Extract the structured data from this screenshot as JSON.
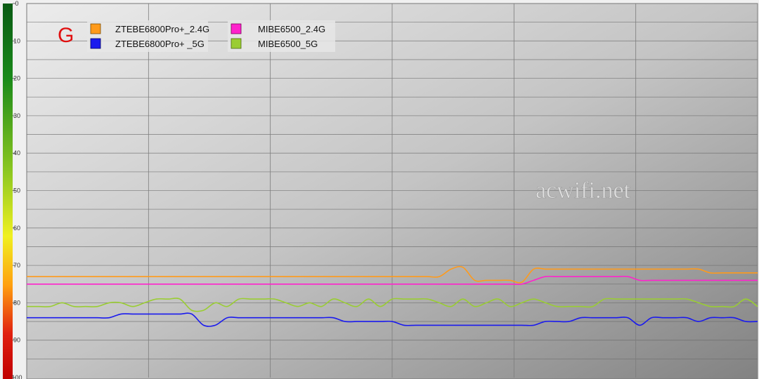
{
  "chart_data": {
    "type": "line",
    "ylim": [
      0,
      100
    ],
    "y_inverted": true,
    "y_ticks": [
      "0",
      "10",
      "20",
      "30",
      "40",
      "50",
      "60",
      "70",
      "80",
      "90",
      "100"
    ],
    "grid": true,
    "legend_position": "top-left",
    "marker_label": "G",
    "watermark": "acwifi.net",
    "x": [
      0,
      1,
      2,
      3,
      4,
      5,
      6,
      7,
      8,
      9,
      10,
      11,
      12,
      13,
      14,
      15,
      16,
      17,
      18,
      19,
      20,
      21,
      22,
      23,
      24,
      25,
      26,
      27,
      28,
      29,
      30,
      31,
      32,
      33,
      34,
      35,
      36,
      37,
      38,
      39,
      40,
      41,
      42,
      43,
      44,
      45,
      46,
      47,
      48,
      49,
      50,
      51,
      52,
      53,
      54,
      55,
      56,
      57,
      58,
      59,
      60,
      61,
      62
    ],
    "series": [
      {
        "name": "ZTEBE6800Pro+_2.4G",
        "color": "#ff9a1a",
        "values": [
          73,
          73,
          73,
          73,
          73,
          73,
          73,
          73,
          73,
          73,
          73,
          73,
          73,
          73,
          73,
          73,
          73,
          73,
          73,
          73,
          73,
          73,
          73,
          73,
          73,
          73,
          73,
          73,
          73,
          73,
          73,
          73,
          73,
          73,
          73,
          73,
          71,
          70.5,
          74,
          74,
          74,
          74,
          74.5,
          71,
          71,
          71,
          71,
          71,
          71,
          71,
          71,
          71,
          71,
          71,
          71,
          71,
          71,
          71,
          72,
          72,
          72,
          72,
          72
        ]
      },
      {
        "name": "MIBE6500_2.4G",
        "color": "#ff22cc",
        "values": [
          75,
          75,
          75,
          75,
          75,
          75,
          75,
          75,
          75,
          75,
          75,
          75,
          75,
          75,
          75,
          75,
          75,
          75,
          75,
          75,
          75,
          75,
          75,
          75,
          75,
          75,
          75,
          75,
          75,
          75,
          75,
          75,
          75,
          75,
          75,
          75,
          75,
          75,
          75,
          75,
          75,
          75,
          75,
          74,
          73,
          73,
          73,
          73,
          73,
          73,
          73,
          73,
          74,
          74,
          74,
          74,
          74,
          74,
          74,
          74,
          74,
          74,
          74
        ]
      },
      {
        "name": "ZTEBE6800Pro+ _5G",
        "color": "#1a1aee",
        "values": [
          84,
          84,
          84,
          84,
          84,
          84,
          84,
          84,
          83,
          83,
          83,
          83,
          83,
          83,
          83,
          86,
          86,
          84,
          84,
          84,
          84,
          84,
          84,
          84,
          84,
          84,
          84,
          85,
          85,
          85,
          85,
          85,
          86,
          86,
          86,
          86,
          86,
          86,
          86,
          86,
          86,
          86,
          86,
          86,
          85,
          85,
          85,
          84,
          84,
          84,
          84,
          84,
          86,
          84,
          84,
          84,
          84,
          85,
          84,
          84,
          84,
          85,
          85
        ]
      },
      {
        "name": "MIBE6500_5G",
        "color": "#9acd32",
        "values": [
          81,
          81,
          81,
          80,
          81,
          81,
          81,
          80,
          80,
          81,
          80,
          79,
          79,
          79,
          82,
          82,
          80,
          81,
          79,
          79,
          79,
          79,
          80,
          81,
          80,
          81,
          79,
          80,
          81,
          79,
          81,
          79,
          79,
          79,
          79,
          80,
          81,
          79,
          81,
          80,
          79,
          81,
          80,
          79,
          80,
          81,
          81,
          81,
          81,
          79,
          79,
          79,
          79,
          79,
          79,
          79,
          79,
          80,
          81,
          81,
          81,
          79,
          81
        ]
      }
    ]
  }
}
